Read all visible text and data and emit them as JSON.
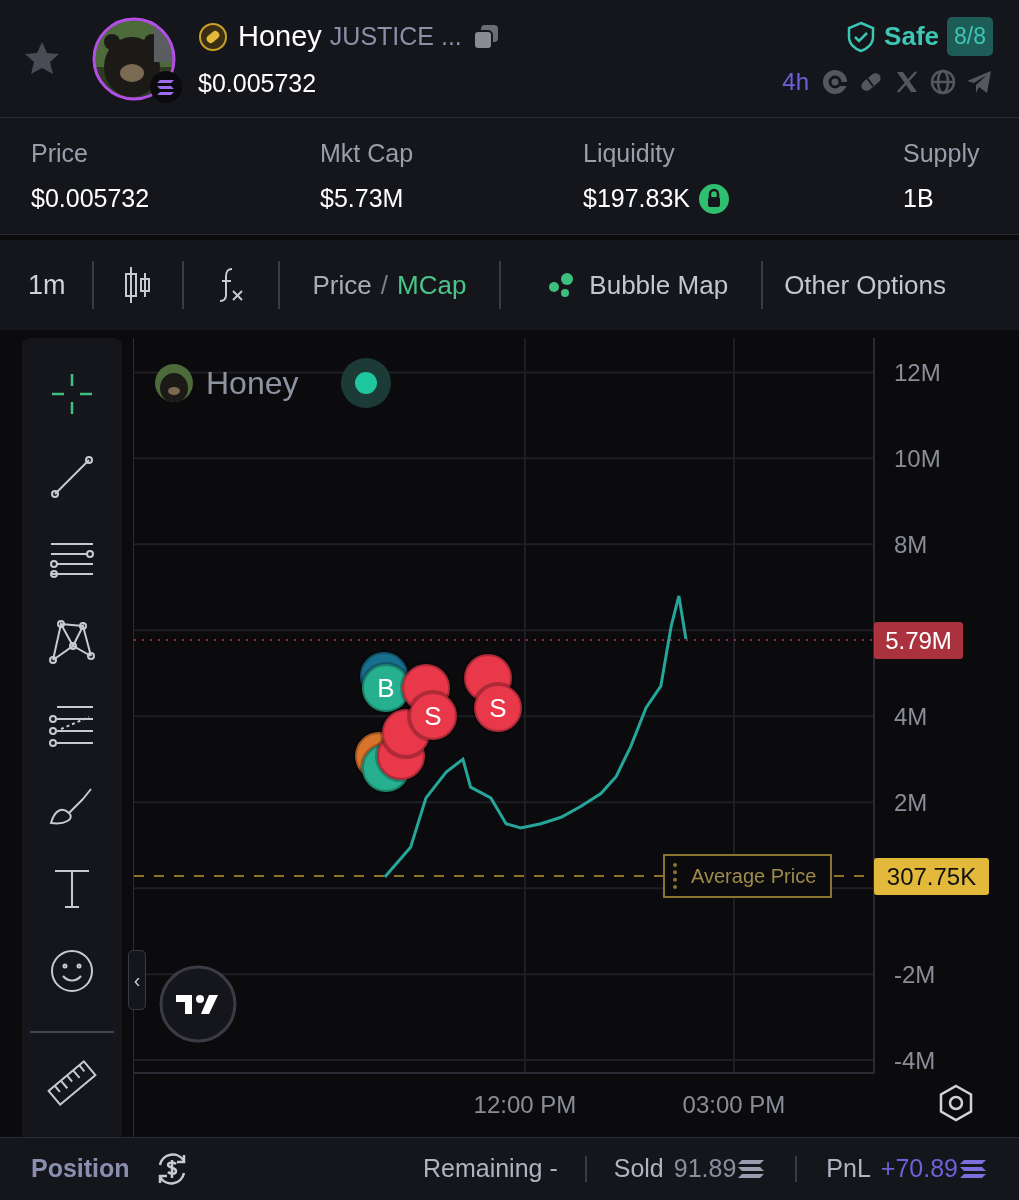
{
  "header": {
    "favorited": false,
    "token_name": "Honey",
    "token_subtitle": "JUSTICE ...",
    "price": "$0.005732",
    "safety": {
      "label": "Safe",
      "score": "8/8"
    },
    "age": "4h"
  },
  "stats": [
    {
      "label": "Price",
      "value": "$0.005732",
      "locked": false
    },
    {
      "label": "Mkt Cap",
      "value": "$5.73M",
      "locked": false
    },
    {
      "label": "Liquidity",
      "value": "$197.83K",
      "locked": true
    },
    {
      "label": "Supply",
      "value": "1B",
      "locked": false
    }
  ],
  "toolbar": {
    "interval": "1m",
    "price_toggle": [
      {
        "label": "Price",
        "selected": false
      },
      {
        "label": "MCap",
        "selected": true
      }
    ],
    "separator": "/",
    "bubble_map": "Bubble Map",
    "other": "Other Options"
  },
  "tools": [
    {
      "kind": "crosshair",
      "selected": true
    },
    {
      "kind": "trendline",
      "selected": false
    },
    {
      "kind": "hlines",
      "selected": false
    },
    {
      "kind": "pattern",
      "selected": false
    },
    {
      "kind": "fib",
      "selected": false
    },
    {
      "kind": "brush",
      "selected": false
    },
    {
      "kind": "text",
      "selected": false
    },
    {
      "kind": "emoji",
      "selected": false
    },
    {
      "kind": "ruler",
      "selected": false
    }
  ],
  "chart": {
    "collapse_glyph": "‹",
    "average_label": "Average Price",
    "chart_data": {
      "type": "line",
      "x": [
        9.99,
        10.36,
        10.58,
        10.87,
        11.11,
        11.22,
        11.51,
        11.73,
        11.94,
        12.23,
        12.52,
        12.8,
        13.09,
        13.31,
        13.52,
        13.74,
        13.95,
        14.1,
        14.21,
        14.31
      ],
      "series": [
        {
          "name": "Honey",
          "color": "#26a69a",
          "values": [
            0.26,
            0.95,
            2.1,
            2.7,
            3.0,
            2.35,
            2.1,
            1.5,
            1.4,
            1.5,
            1.65,
            1.9,
            2.2,
            2.6,
            3.3,
            4.2,
            4.7,
            6.1,
            6.8,
            5.8
          ]
        }
      ],
      "xlim": [
        6.39,
        17.01
      ],
      "ylim": [
        -4.3,
        12.8
      ],
      "xticks": [
        {
          "value": 12,
          "label": "12:00 PM"
        },
        {
          "value": 15,
          "label": "03:00 PM"
        }
      ],
      "yticks": [
        {
          "value": 12,
          "label": "12M"
        },
        {
          "value": 10,
          "label": "10M"
        },
        {
          "value": 8,
          "label": "8M"
        },
        {
          "value": 4,
          "label": "4M"
        },
        {
          "value": 2,
          "label": "2M"
        },
        {
          "value": -2,
          "label": "-2M"
        },
        {
          "value": -4,
          "label": "-4M"
        }
      ],
      "grid": true
    },
    "price_levels": [
      {
        "kind": "last",
        "label": "5.79M"
      },
      {
        "kind": "average",
        "label": "307.75K"
      }
    ],
    "trade_markers": [
      {
        "kind": "other"
      },
      {
        "kind": "buy",
        "label": "B"
      },
      {
        "kind": "alert"
      },
      {
        "kind": "buy"
      },
      {
        "kind": "sell"
      },
      {
        "kind": "sell"
      },
      {
        "kind": "sell"
      },
      {
        "kind": "sell",
        "label": "S"
      },
      {
        "kind": "sell"
      },
      {
        "kind": "sell",
        "label": "S"
      }
    ]
  },
  "position": {
    "title": "Position",
    "remaining": "Remaining -",
    "sold_label": "Sold",
    "sold": "91.89",
    "pnl_label": "PnL",
    "pnl": "+70.89"
  }
}
